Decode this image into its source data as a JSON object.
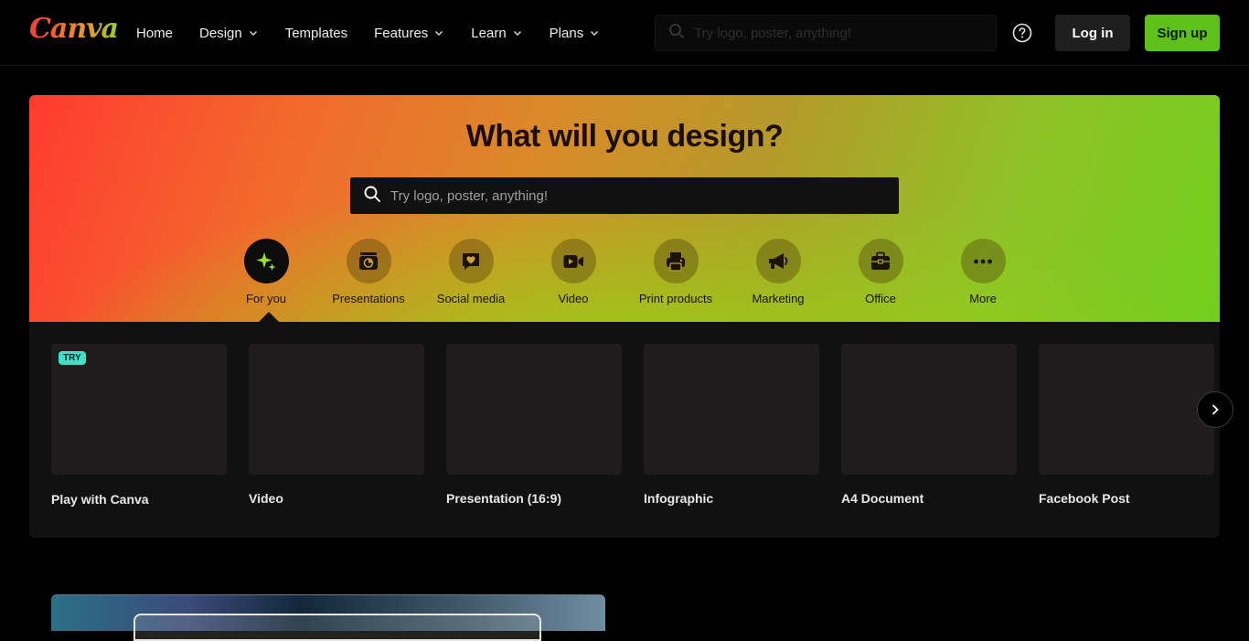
{
  "brand": {
    "logo_text": "Canva"
  },
  "nav": {
    "items": [
      {
        "label": "Home",
        "has_dropdown": false
      },
      {
        "label": "Design",
        "has_dropdown": true
      },
      {
        "label": "Templates",
        "has_dropdown": false
      },
      {
        "label": "Features",
        "has_dropdown": true
      },
      {
        "label": "Learn",
        "has_dropdown": true
      },
      {
        "label": "Plans",
        "has_dropdown": true
      }
    ],
    "search_placeholder": "Try logo, poster, anything!",
    "login_label": "Log in",
    "signup_label": "Sign up"
  },
  "hero": {
    "title": "What will you design?",
    "search_placeholder": "Try logo, poster, anything!",
    "categories": [
      {
        "label": "For you",
        "icon": "sparkle-icon",
        "active": true
      },
      {
        "label": "Presentations",
        "icon": "presentation-chart-icon",
        "active": false
      },
      {
        "label": "Social media",
        "icon": "heart-message-icon",
        "active": false
      },
      {
        "label": "Video",
        "icon": "video-camera-icon",
        "active": false
      },
      {
        "label": "Print products",
        "icon": "printer-icon",
        "active": false
      },
      {
        "label": "Marketing",
        "icon": "megaphone-icon",
        "active": false
      },
      {
        "label": "Office",
        "icon": "briefcase-icon",
        "active": false
      },
      {
        "label": "More",
        "icon": "more-dots-icon",
        "active": false
      }
    ]
  },
  "cards": [
    {
      "label": "Play with Canva",
      "badge": "TRY"
    },
    {
      "label": "Video",
      "badge": ""
    },
    {
      "label": "Presentation (16:9)",
      "badge": ""
    },
    {
      "label": "Infographic",
      "badge": ""
    },
    {
      "label": "A4 Document",
      "badge": ""
    },
    {
      "label": "Facebook Post",
      "badge": ""
    }
  ],
  "colors": {
    "signup_bg": "#5fbf1b",
    "login_bg": "#1f1f1f",
    "try_badge": "#3fe0c5",
    "hero_gradient_start": "#ff3a30",
    "hero_gradient_end": "#72cf1c"
  }
}
